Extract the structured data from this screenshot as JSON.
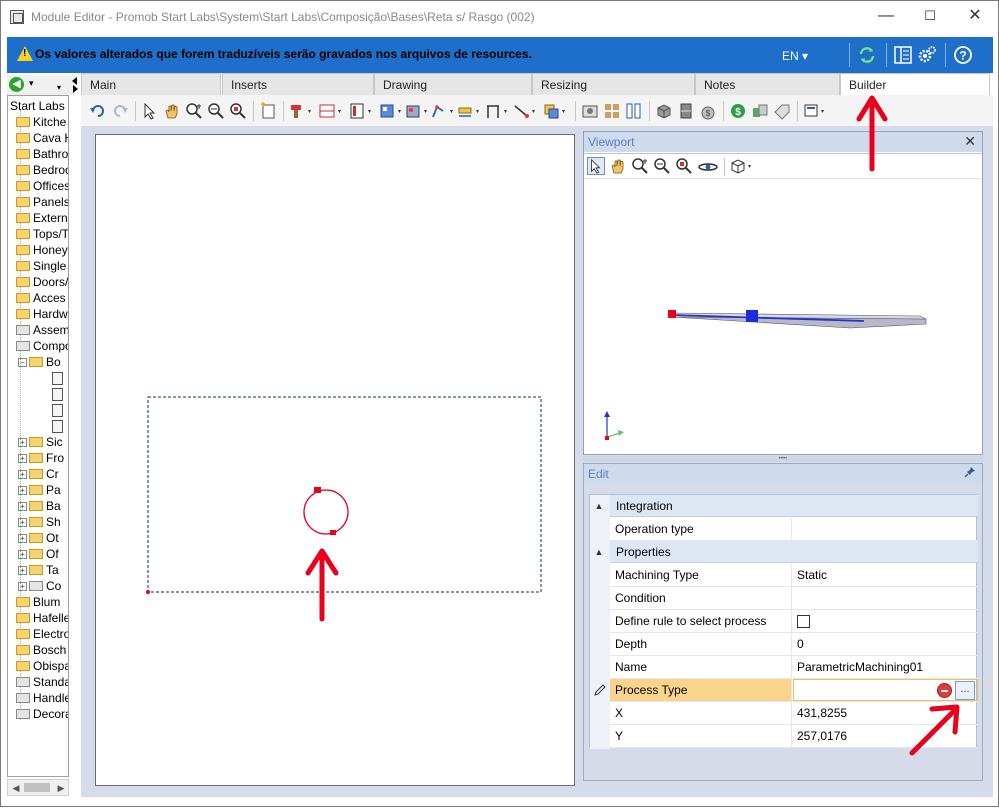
{
  "window": {
    "title": "Module Editor - Promob Start Labs\\System\\Start Labs\\Composição\\Bases\\Reta s/ Rasgo (002)",
    "minimize": "—",
    "maximize": "☐",
    "close": "✕"
  },
  "notice": {
    "message": "Os valores alterados que forem traduzíveis serão gravados nos arquivos de resources.",
    "language": "EN ▾"
  },
  "tree": {
    "root": "Start Labs",
    "items": [
      "Kitche",
      "Cava H",
      "Bathro",
      "Bedroo",
      "Offices",
      "Panels",
      "Extern",
      "Tops/T",
      "Honey",
      "Single",
      "Doors/",
      "Acces",
      "Hardw",
      "Assem",
      "Compo"
    ],
    "sub_open": "Bo",
    "sub_items": [
      "Sic",
      "Fro",
      "Cr",
      "Pa",
      "Ba",
      "Sh",
      "Ot",
      "Of",
      "Ta",
      "Co"
    ],
    "bottom_items": [
      "Blum",
      "Hafelle",
      "Electro",
      "Bosch",
      "Obispa",
      "Standa",
      "Handle",
      "Decora"
    ]
  },
  "tabs": [
    "Main",
    "Inserts",
    "Drawing",
    "Resizing",
    "Notes",
    "Builder"
  ],
  "viewport": {
    "title": "Viewport",
    "close": "✕"
  },
  "edit": {
    "title": "Edit",
    "categories": {
      "integration": "Integration",
      "properties": "Properties"
    },
    "rows": {
      "operation_type": {
        "label": "Operation type",
        "value": ""
      },
      "machining_type": {
        "label": "Machining Type",
        "value": "Static"
      },
      "condition": {
        "label": "Condition",
        "value": ""
      },
      "define_rule": {
        "label": "Define rule to select process",
        "checked": false
      },
      "depth": {
        "label": "Depth",
        "value": "0"
      },
      "name": {
        "label": "Name",
        "value": "ParametricMachining01"
      },
      "process_type": {
        "label": "Process Type",
        "value": ""
      },
      "x": {
        "label": "X",
        "value": "431,8255"
      },
      "y": {
        "label": "Y",
        "value": "257,0176"
      }
    },
    "ellipsis_label": "..."
  },
  "colors": {
    "notice_bar": "#1e6fc9",
    "accent_red": "#e8001c",
    "panel_bg": "#d6dbe9",
    "highlight_row": "#fbd48c"
  }
}
